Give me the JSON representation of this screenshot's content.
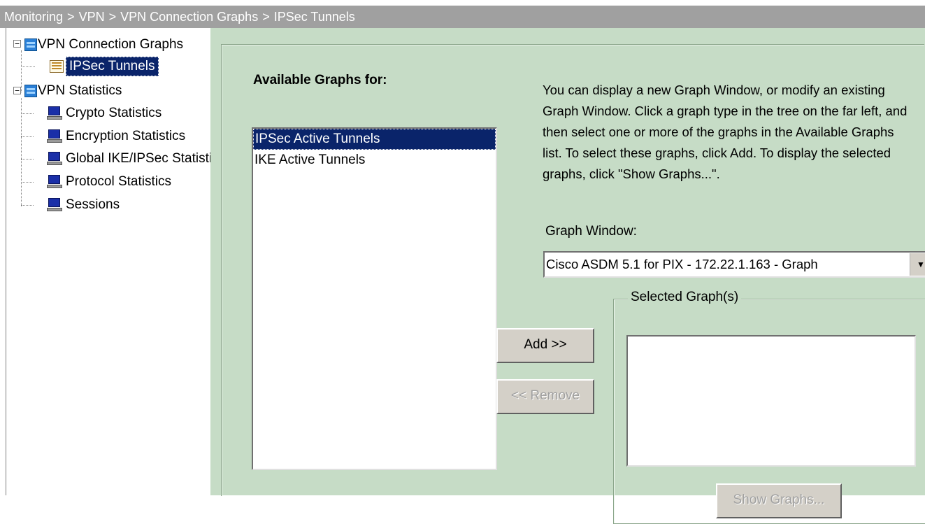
{
  "breadcrumb": [
    "Monitoring",
    "VPN",
    "VPN Connection Graphs",
    "IPSec Tunnels"
  ],
  "breadcrumb_separator": ">",
  "tree": {
    "groups": [
      {
        "label": "VPN Connection Graphs",
        "expander": "−",
        "icon": "folder-icon",
        "children": [
          {
            "label": "IPSec Tunnels",
            "icon": "graph-icon",
            "selected": true
          }
        ]
      },
      {
        "label": "VPN Statistics",
        "expander": "−",
        "icon": "folder-icon",
        "children": [
          {
            "label": "Crypto Statistics",
            "icon": "monitor-icon"
          },
          {
            "label": "Encryption Statistics",
            "icon": "monitor-icon"
          },
          {
            "label": "Global IKE/IPSec Statistics",
            "icon": "monitor-icon"
          },
          {
            "label": "Protocol Statistics",
            "icon": "monitor-icon"
          },
          {
            "label": "Sessions",
            "icon": "monitor-icon"
          }
        ]
      }
    ]
  },
  "main": {
    "available_label": "Available Graphs for:",
    "available_graphs": [
      {
        "label": "IPSec Active Tunnels",
        "selected": true
      },
      {
        "label": "IKE Active Tunnels",
        "selected": false
      }
    ],
    "help_text": "You can display a new Graph Window, or modify an existing Graph Window. Click a graph type in the tree on the far left, and then select one or more of the graphs in the Available Graphs list. To select these graphs, click Add.  To display the selected graphs, click \"Show Graphs...\".",
    "graph_window_label": "Graph Window:",
    "graph_window_value": "Cisco ASDM 5.1 for PIX - 172.22.1.163 - Graph",
    "add_button": "Add >>",
    "remove_button": "<< Remove",
    "selected_graphs_label": "Selected Graph(s)",
    "selected_graphs": [],
    "show_graphs_button": "Show Graphs..."
  },
  "colors": {
    "main_background": "#c6dcc6",
    "title_bar": "#a0a0a0",
    "selection": "#0a246a"
  }
}
